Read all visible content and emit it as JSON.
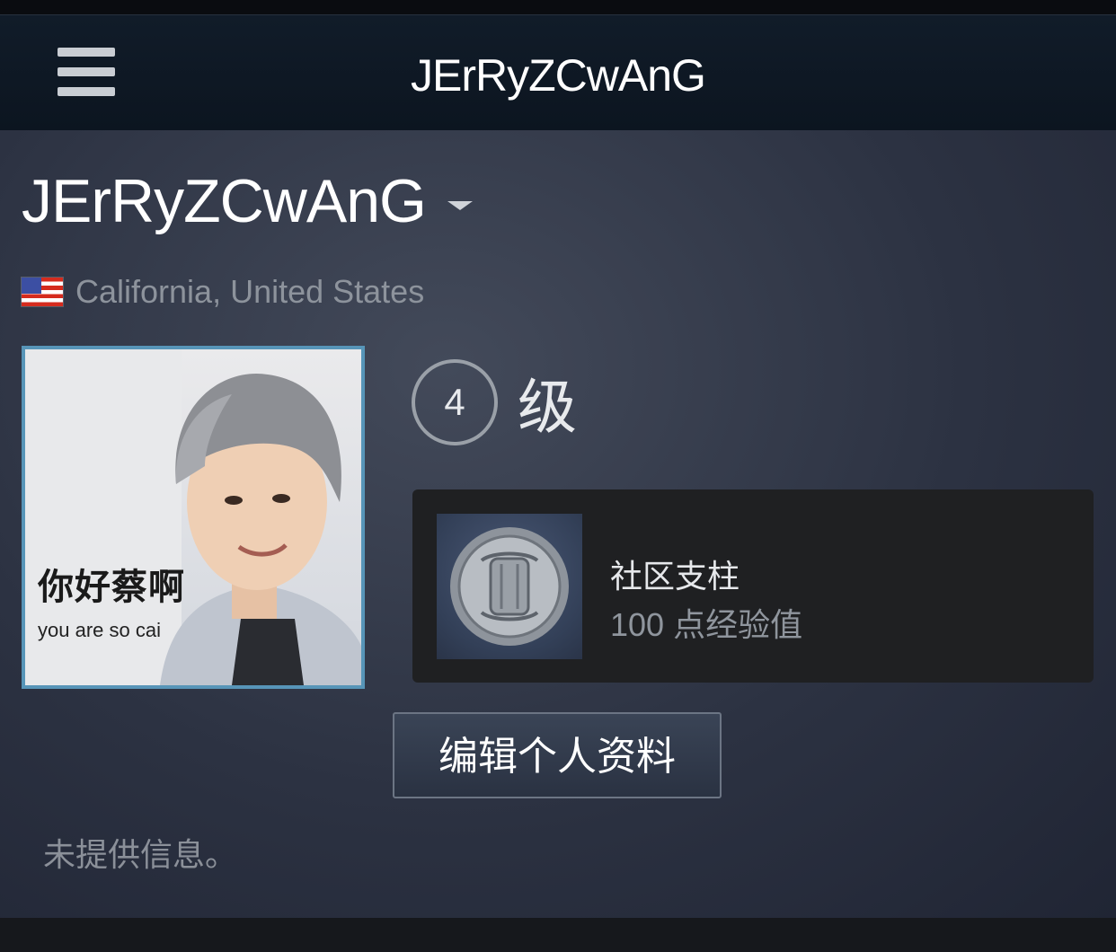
{
  "header": {
    "title": "JErRyZCwAnG",
    "menu_icon": "hamburger-menu-icon"
  },
  "profile": {
    "name": "JErRyZCwAnG",
    "location": "California, United States",
    "location_flag": "us-flag-icon",
    "avatar_caption": "你好蔡啊",
    "avatar_caption_en": "you are so cai"
  },
  "level": {
    "number": "4",
    "label": "级"
  },
  "badge": {
    "name": "社区支柱",
    "xp": "100 点经验值",
    "icon": "pillar-coin-icon"
  },
  "actions": {
    "edit_label": "编辑个人资料"
  },
  "summary": {
    "text": "未提供信息。"
  },
  "colors": {
    "header_bg": "#0c1520",
    "main_bg": "#2c3242",
    "avatar_border": "#5795b8",
    "badge_card_bg": "#1f2022"
  }
}
